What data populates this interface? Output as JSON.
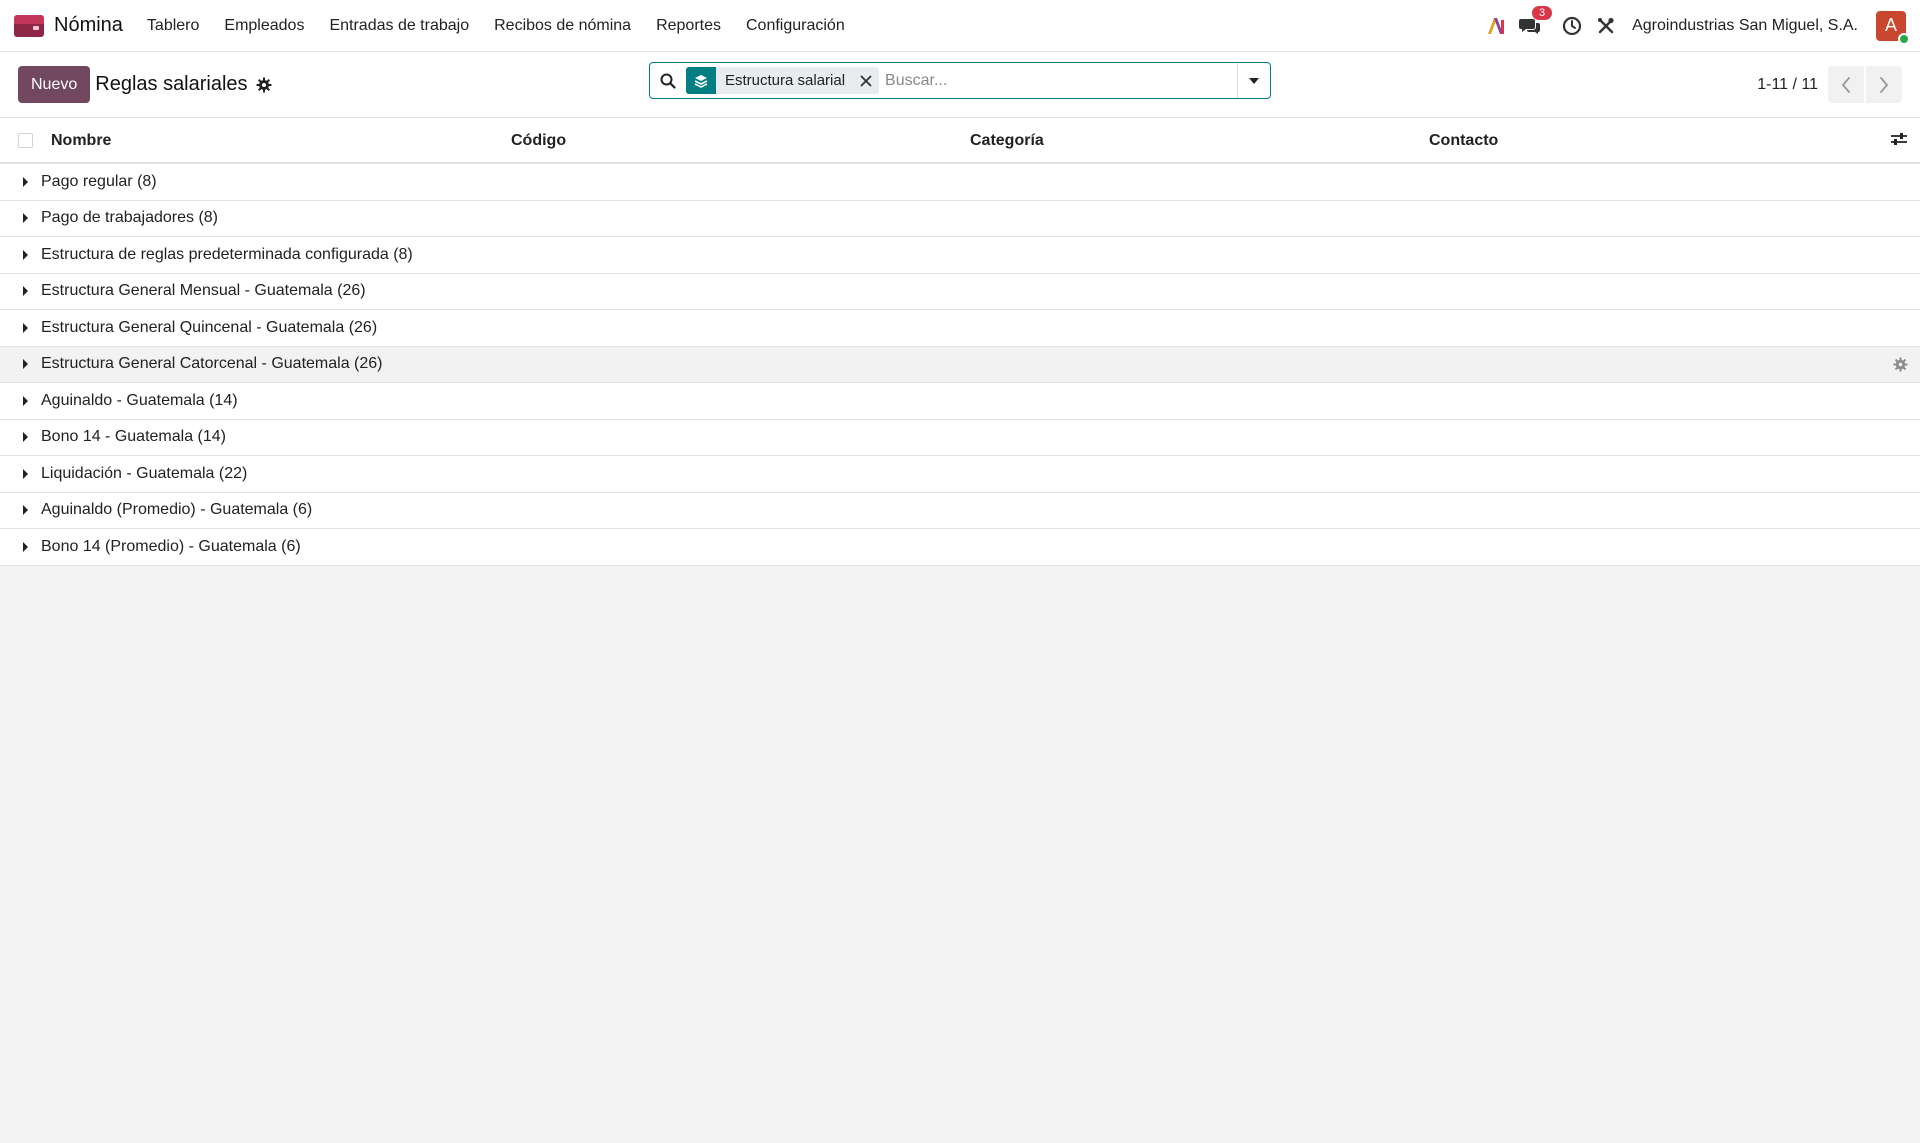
{
  "app": {
    "name": "Nómina",
    "icon": "payroll-app-icon"
  },
  "navbar": {
    "menu": [
      "Tablero",
      "Empleados",
      "Entradas de trabajo",
      "Recibos de nómina",
      "Reportes",
      "Configuración"
    ],
    "messages_count": "3",
    "company": "Agroindustrias San Miguel, S.A.",
    "avatar_letter": "A"
  },
  "control": {
    "new_label": "Nuevo",
    "title": "Reglas salariales",
    "search": {
      "facet_label": "Estructura salarial",
      "placeholder": "Buscar..."
    },
    "pager": "1-11 / 11"
  },
  "list": {
    "columns": [
      "Nombre",
      "Código",
      "Categoría",
      "Contacto"
    ],
    "groups": [
      "Pago regular (8)",
      "Pago de trabajadores (8)",
      "Estructura de reglas predeterminada configurada (8)",
      "Estructura General Mensual - Guatemala (26)",
      "Estructura General Quincenal - Guatemala (26)",
      "Estructura General Catorcenal - Guatemala (26)",
      "Aguinaldo - Guatemala (14)",
      "Bono 14 - Guatemala (14)",
      "Liquidación - Guatemala (22)",
      "Aguinaldo (Promedio) - Guatemala (6)",
      "Bono 14 (Promedio) - Guatemala (6)"
    ],
    "hovered_group_index": 5
  },
  "colors": {
    "primary": "#71485f",
    "accent": "#017e84",
    "badge": "#d9364a",
    "avatar": "#c9472f"
  }
}
